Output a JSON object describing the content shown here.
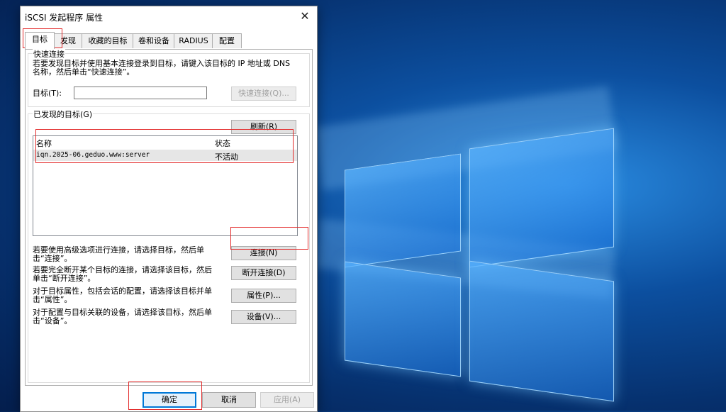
{
  "dialog": {
    "title": "iSCSI 发起程序 属性",
    "close_glyph": "✕"
  },
  "tabs": [
    "目标",
    "发现",
    "收藏的目标",
    "卷和设备",
    "RADIUS",
    "配置"
  ],
  "quick_connect": {
    "group_label": "快速连接",
    "description": "若要发现目标并使用基本连接登录到目标，请键入该目标的 IP 地址或 DNS 名称，然后单击“快速连接”。",
    "target_label": "目标(T):",
    "target_value": "",
    "button": "快速连接(Q)..."
  },
  "discovered": {
    "group_label": "已发现的目标(G)",
    "refresh_button": "刷新(R)",
    "columns": [
      "名称",
      "状态"
    ],
    "rows": [
      {
        "name": "iqn.2025-06.geduo.www:server",
        "status": "不活动"
      }
    ]
  },
  "actions": [
    {
      "text": "若要使用高级选项进行连接，请选择目标，然后单击“连接”。",
      "button": "连接(N)"
    },
    {
      "text": "若要完全断开某个目标的连接，请选择该目标，然后单击“断开连接”。",
      "button": "断开连接(D)"
    },
    {
      "text": "对于目标属性，包括会话的配置，请选择该目标并单击“属性”。",
      "button": "属性(P)..."
    },
    {
      "text": "对于配置与目标关联的设备，请选择该目标，然后单击“设备”。",
      "button": "设备(V)..."
    }
  ],
  "footer": {
    "ok": "确定",
    "cancel": "取消",
    "apply": "应用(A)"
  },
  "colors": {
    "highlight": "#e32b2b",
    "accent": "#0078d7",
    "desktop": "#0c4f9f"
  }
}
